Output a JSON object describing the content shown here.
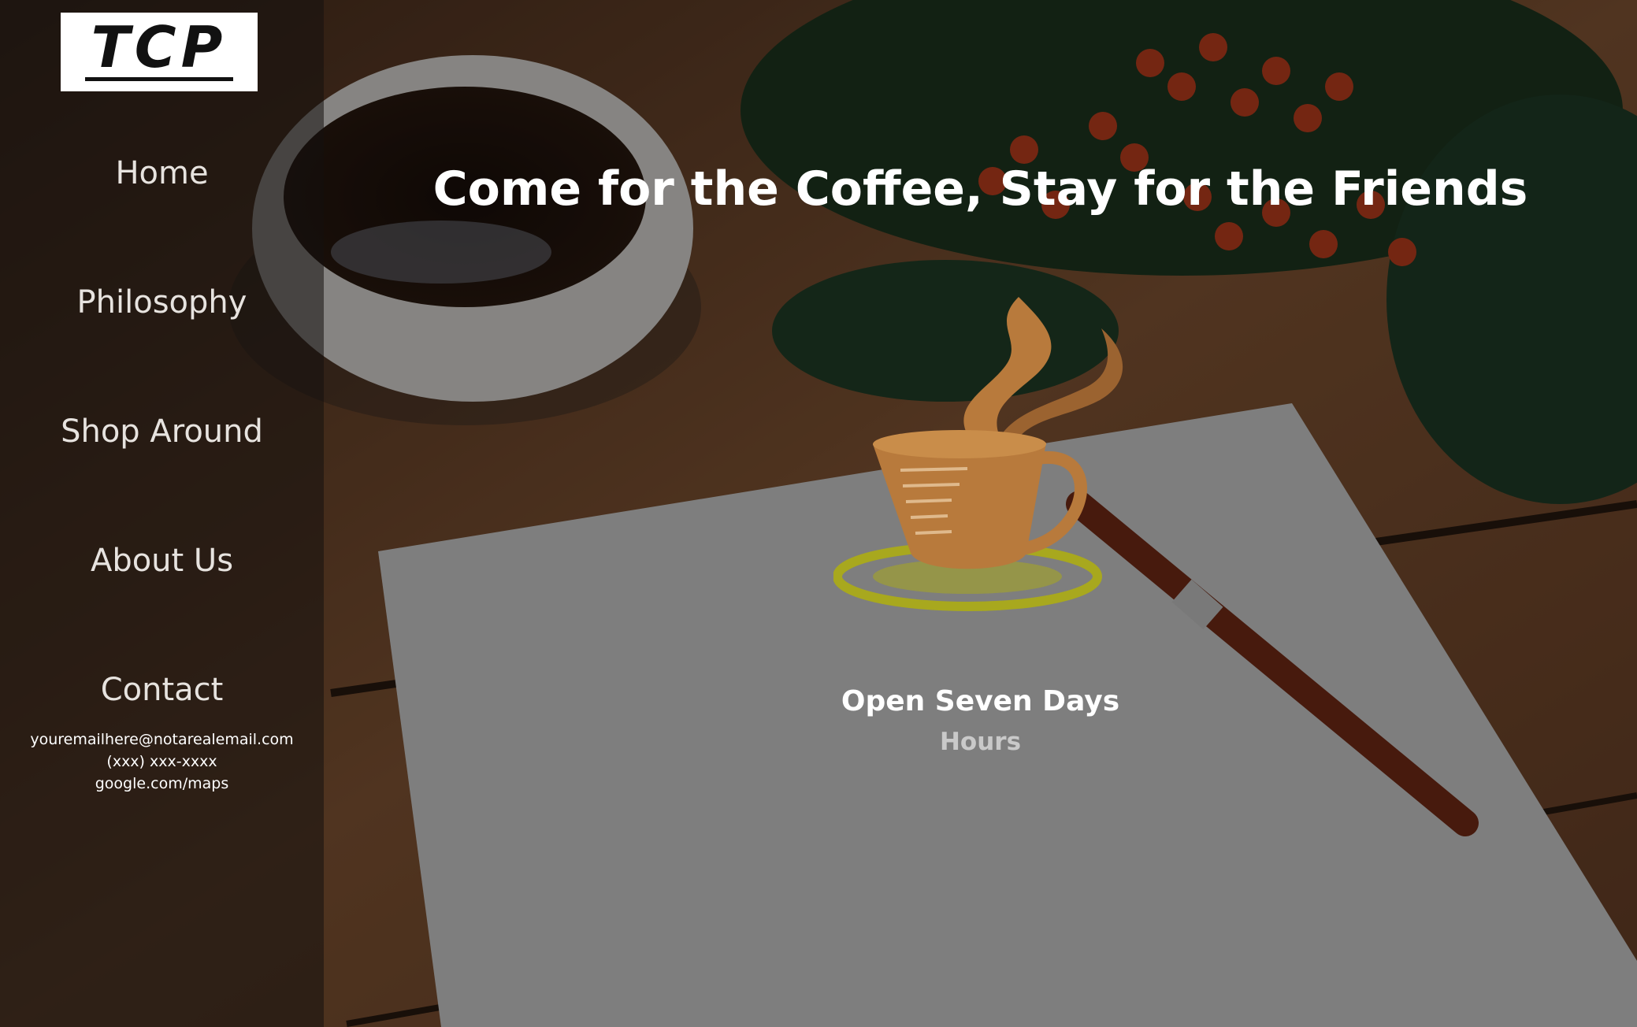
{
  "brand": {
    "logo_text": "TCP"
  },
  "nav": {
    "items": [
      {
        "label": "Home"
      },
      {
        "label": "Philosophy"
      },
      {
        "label": "Shop Around"
      },
      {
        "label": "About Us"
      },
      {
        "label": "Contact"
      }
    ]
  },
  "contact": {
    "email": "youremailhere@notarealemail.com",
    "phone": "(xxx) xxx-xxxx",
    "map": "google.com/maps"
  },
  "hero": {
    "headline": "Come for the Coffee, Stay for the Friends",
    "hours_title": "Open Seven Days",
    "hours_link": "Hours"
  },
  "colors": {
    "cup_orange": "#b87a3c",
    "saucer_green": "#a8a81e",
    "sidebar_bg": "#14100e"
  },
  "icons": {
    "cup": "coffee-cup-logo-icon"
  }
}
